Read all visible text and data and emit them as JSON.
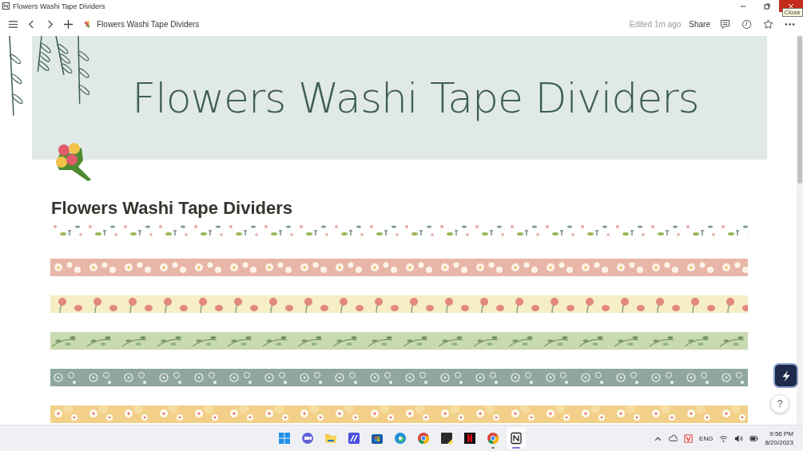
{
  "window": {
    "title": "Flowers Washi Tape Dividers",
    "tooltip": "Close"
  },
  "toolbar": {
    "breadcrumb": "Flowers Washi Tape Dividers",
    "edited": "Edited 1m ago",
    "share": "Share"
  },
  "cover": {
    "title": "Flowers Washi Tape Dividers"
  },
  "page": {
    "heading": "Flowers Washi Tape Dividers"
  },
  "help": "?",
  "taskbar": {
    "apps": [
      {
        "kind": "start",
        "selected": false,
        "running": false
      },
      {
        "kind": "chat",
        "selected": false,
        "running": false
      },
      {
        "kind": "folder",
        "selected": false,
        "running": false
      },
      {
        "kind": "editor",
        "selected": false,
        "running": false
      },
      {
        "kind": "store",
        "selected": false,
        "running": false
      },
      {
        "kind": "edge",
        "selected": false,
        "running": false
      },
      {
        "kind": "chrome",
        "selected": false,
        "running": false
      },
      {
        "kind": "notes",
        "selected": false,
        "running": false
      },
      {
        "kind": "netflix",
        "selected": false,
        "running": false
      },
      {
        "kind": "chrome",
        "selected": false,
        "running": true
      },
      {
        "kind": "notion",
        "selected": true,
        "running": true
      }
    ],
    "tray": {
      "language": "ENG",
      "time": "9:56 PM",
      "date": "8/20/2023"
    }
  }
}
